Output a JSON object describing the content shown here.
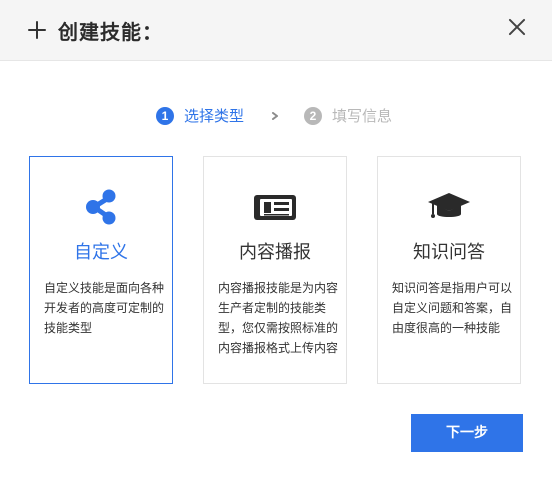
{
  "dialog": {
    "title": "创建技能：",
    "header_icon": "plus-icon",
    "close_icon": "close-icon"
  },
  "steps": [
    {
      "number": "1",
      "label": "选择类型",
      "color": "#2f74e8"
    },
    {
      "number": "2",
      "label": "填写信息",
      "color": "#b8b8b8"
    }
  ],
  "step_separator_icon": "chevron-right-icon",
  "cards": [
    {
      "icon": "share-icon",
      "title": "自定义",
      "description": "自定义技能是面向各种开发者的高度可定制的技能类型",
      "selected": true
    },
    {
      "icon": "newspaper-icon",
      "title": "内容播报",
      "description": "内容播报技能是为内容生产者定制的技能类型，您仅需按照标准的内容播报格式上传内容",
      "selected": false
    },
    {
      "icon": "graduation-cap-icon",
      "title": "知识问答",
      "description": "知识问答是指用户可以自定义问题和答案，自由度很高的一种技能",
      "selected": false
    }
  ],
  "next_button": {
    "label": "下一步"
  },
  "colors": {
    "accent": "#2f74e8",
    "header_bg": "#f5f5f5",
    "inactive_step": "#b8b8b8",
    "text": "#333333",
    "border": "#e3e3e3"
  }
}
